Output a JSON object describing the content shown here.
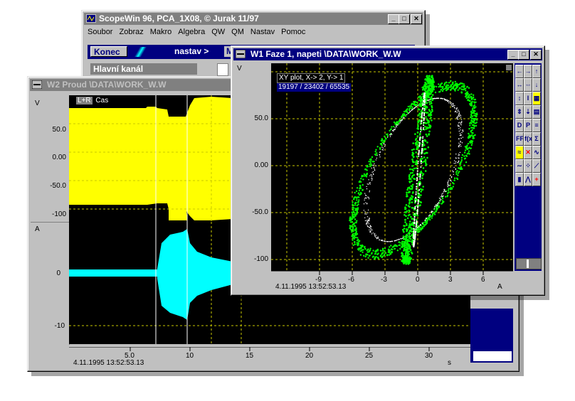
{
  "main_window": {
    "title": "ScopeWin 96, PCA_1X08, © Jurak 11/97",
    "menu": [
      "Soubor",
      "Zobraz",
      "Makro",
      "Algebra",
      "QW",
      "QM",
      "Nastav",
      "Pomoc"
    ],
    "konec_label": "Konec",
    "nastav_label": "nastav >",
    "m_label": "M",
    "channel_label": "Hlavní kanál"
  },
  "w2": {
    "title": "W2 Proud \\DATA\\WORK_W.W",
    "top_unit": "V",
    "bottom_unit": "A",
    "legend_tag": "L+R",
    "legend_text": "Cas",
    "top_yticks": [
      "50.0",
      "0.00",
      "-50.0",
      "-100"
    ],
    "bottom_yticks": [
      "0",
      "-10"
    ],
    "xticks": [
      "5.0",
      "10",
      "15",
      "20",
      "25",
      "30"
    ],
    "x_unit": "s",
    "timestamp": "4.11.1995   13:52:53.13"
  },
  "w1": {
    "title": "W1 Faze 1, napeti \\DATA\\WORK_W.W",
    "y_unit": "V",
    "info_line1": "XY plot,  X-> 2, Y-> 1",
    "info_line2": "19197 / 23402 / 65535",
    "yticks": [
      "50.0",
      "0.00",
      "-50.0",
      "-100"
    ],
    "xticks": [
      "-9",
      "-6",
      "-3",
      "0",
      "3",
      "6"
    ],
    "x_unit": "A",
    "timestamp": "4.11.1995   13:52:53.13",
    "toolbar_icons": [
      "arrow-left-icon",
      "arrow-right-icon",
      "arrow-up-icon",
      "expand-horizontal-icon",
      "compress-horizontal-icon",
      "arrow-down-icon",
      "expand-vertical-icon",
      "cursor-i-icon",
      "grid-yellow-icon",
      "compress-vertical-icon",
      "compress-vertical-2-icon",
      "window-tile-icon",
      "displ-icon",
      "printer-icon",
      "table-icon",
      "fft-icon",
      "fx-icon",
      "sigma-icon",
      "wave-yellow-icon",
      "cross-red-icon",
      "wave-multi-icon",
      "wave-blue-icon",
      "dots-icon",
      "graph-icon",
      "bars-icon",
      "peak-icon",
      "plus-red-icon"
    ],
    "toolbar_glyphs": [
      "←",
      "→",
      "↑",
      "↔",
      "⇔",
      "↓",
      "↕",
      "I",
      "▦",
      "⇕",
      "⇣",
      "▤",
      "D",
      "P",
      "≡",
      "FFT",
      "f(x)",
      "Σ",
      "≈",
      "✕",
      "∿",
      "∼",
      "⁘",
      "⟋",
      "▮",
      "⋀",
      "+"
    ],
    "toolbar_colors": {
      "bg": "#000080",
      "yellow": "#ffff00",
      "red": "#ff0000"
    }
  },
  "colors": {
    "titlebar_active": "#000080",
    "titlebar_inactive": "#808080",
    "trace_yellow": "#ffff00",
    "trace_cyan": "#00ffff",
    "trace_green": "#00ff00",
    "grid": "#c9c900"
  }
}
